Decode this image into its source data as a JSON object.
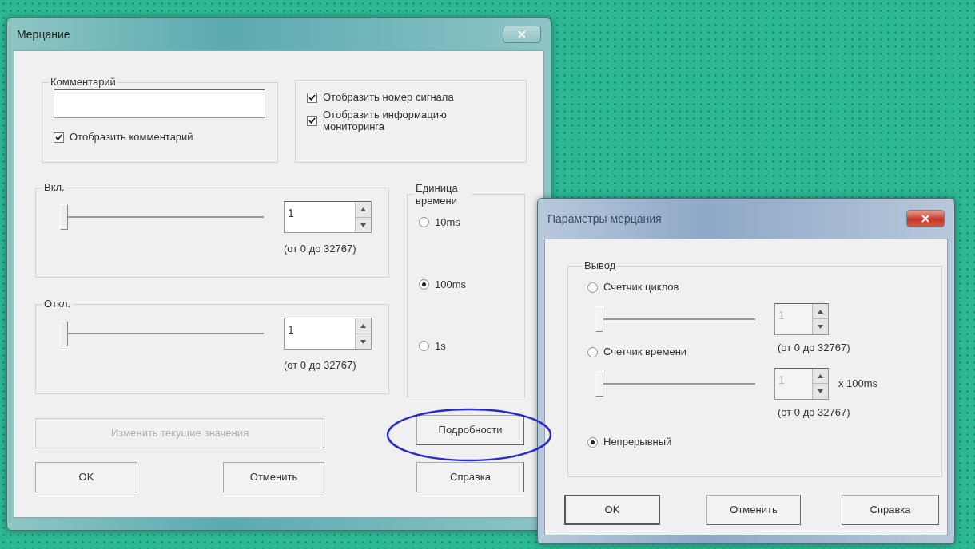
{
  "main_dialog": {
    "title": "Мерцание",
    "active": false,
    "comment_group": {
      "label": "Комментарий",
      "show_comment": {
        "label": "Отобразить комментарий",
        "checked": true
      }
    },
    "display_options": [
      {
        "label": "Отобразить номер сигнала",
        "checked": true
      },
      {
        "label": "Отобразить информацию мониторинга",
        "checked": true
      }
    ],
    "timers": [
      {
        "label": "Вкл.",
        "level": 0,
        "value": "1",
        "range": "(от 0 до 32767)"
      },
      {
        "label": "Откл.",
        "level": 0,
        "value": "1",
        "range": "(от 0 до 32767)"
      }
    ],
    "time_unit": {
      "label": "Единица времени",
      "options": [
        {
          "label": "10ms",
          "selected": false
        },
        {
          "label": "100ms",
          "selected": true
        },
        {
          "label": "1s",
          "selected": false
        }
      ]
    },
    "change_button": {
      "label": "Изменить текущие значения",
      "disabled": true
    },
    "details_button": {
      "label": "Подробности",
      "circled": true
    },
    "buttons": [
      {
        "label": "OK"
      },
      {
        "label": "Отменить"
      },
      {
        "label": "Справка"
      }
    ]
  },
  "params_dialog": {
    "title": "Параметры мерцания",
    "active": true,
    "output_group": {
      "label": "Вывод",
      "options": [
        {
          "kind": "counter",
          "label": "Счетчик циклов",
          "selected": false,
          "level": 0,
          "value": "1",
          "range": "(от 0 до 32767)"
        },
        {
          "kind": "counter",
          "label": "Счетчик времени",
          "selected": false,
          "level": 0,
          "value": "1",
          "unit": "x 100ms",
          "range": "(от 0 до 32767)"
        },
        {
          "kind": "plain",
          "label": "Непрерывный",
          "selected": true
        }
      ]
    },
    "buttons": [
      {
        "label": "OK",
        "default": true
      },
      {
        "label": "Отменить",
        "default": false
      },
      {
        "label": "Справка",
        "default": false
      }
    ]
  }
}
